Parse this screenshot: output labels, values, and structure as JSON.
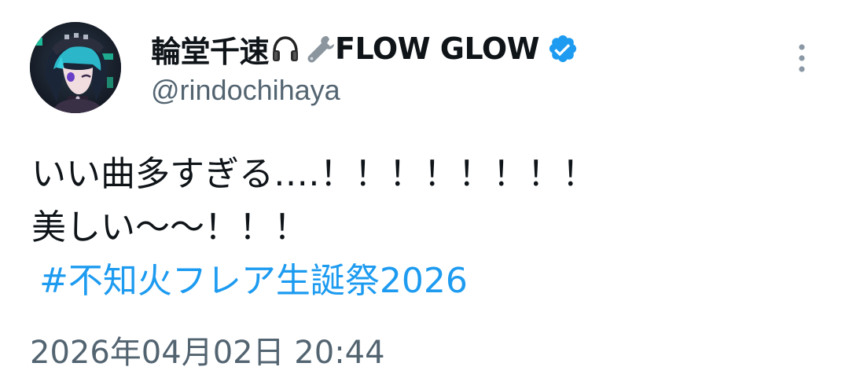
{
  "author": {
    "display_name": "輪堂千速",
    "name_suffix": "FLOW GLOW",
    "handle": "@rindochihaya",
    "name_emojis": [
      "headphone-icon",
      "wrench-icon"
    ],
    "verified_icon": "verified-badge-icon",
    "verified_color": "#1d9bf0"
  },
  "menu": {
    "icon": "more-vertical-icon"
  },
  "post": {
    "lines": [
      "いい曲多すぎる‥‥！！！！！！！！",
      "美しい〜〜！！！"
    ],
    "hashtag": "#不知火フレア生誕祭2026",
    "hashtag_color": "#1d9bf0"
  },
  "timestamp": "2026年04月02日 20:44",
  "colors": {
    "text_primary": "#0f1419",
    "text_secondary": "#536471",
    "accent": "#1d9bf0"
  }
}
